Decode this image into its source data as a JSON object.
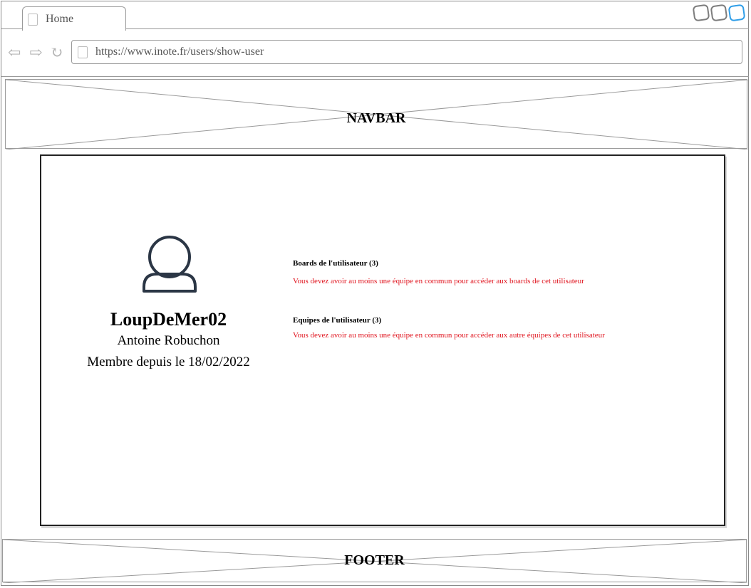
{
  "browser": {
    "tab_title": "Home",
    "url": "https://www.inote.fr/users/show-user"
  },
  "navbar": {
    "label": "NAVBAR"
  },
  "footer": {
    "label": "FOOTER"
  },
  "profile": {
    "username": "LoupDeMer02",
    "full_name": "Antoine Robuchon",
    "member_since": "Membre depuis le 18/02/2022"
  },
  "boards": {
    "title": "Boards de l'utilisateur (3)",
    "message": "Vous devez avoir au moins une équipe en commun pour accéder aux boards de cet utilisateur"
  },
  "teams": {
    "title": "Equipes de l'utilisateur (3)",
    "message": "Vous devez avoir au moins une équipe en commun pour accéder aux autre équipes de cet utilisateur"
  },
  "colors": {
    "warning": "#e0141e",
    "accent": "#2f9ee8"
  }
}
